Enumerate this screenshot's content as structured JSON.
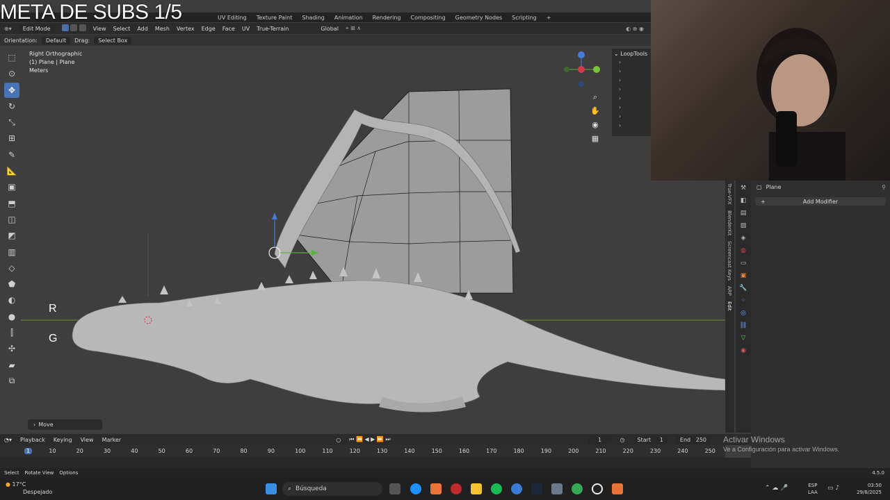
{
  "overlay_title": "META DE SUBS 1/5",
  "topbar": {
    "tabs": [
      "UV Editing",
      "Texture Paint",
      "Shading",
      "Animation",
      "Rendering",
      "Compositing",
      "Geometry Nodes",
      "Scripting",
      "+"
    ]
  },
  "header": {
    "mode": "Edit Mode",
    "menus": [
      "View",
      "Select",
      "Add",
      "Mesh",
      "Vertex",
      "Edge",
      "Face",
      "UV",
      "True-Terrain"
    ],
    "transform_orientation": "Global"
  },
  "tool_settings": {
    "orientation_label": "Orientation:",
    "orientation_value": "Default",
    "drag_label": "Drag:",
    "drag_value": "Select Box"
  },
  "viewport": {
    "view_name": "Right Orthographic",
    "object_info": "(1) Plane | Plane",
    "units": "Meters",
    "key_r": "R",
    "key_g": "G",
    "last_op": "Move",
    "axes": {
      "x": "X",
      "y": "Y",
      "z": "Z"
    }
  },
  "looptools": {
    "title": "LoopTools",
    "rows": 8
  },
  "sidebar_tabs": [
    "True-VFX",
    "BlenderKit",
    "Screencast Keys",
    "ARP",
    "Edit"
  ],
  "properties": {
    "object_name": "Plane",
    "add_modifier": "Add Modifier"
  },
  "timeline": {
    "menus": [
      "Playback",
      "Keying",
      "View",
      "Marker"
    ],
    "current_frame": "1",
    "start_label": "Start",
    "start_value": "1",
    "end_label": "End",
    "end_value": "250",
    "ruler": [
      "1",
      "10",
      "20",
      "30",
      "40",
      "50",
      "60",
      "70",
      "80",
      "90",
      "100",
      "110",
      "120",
      "130",
      "140",
      "150",
      "160",
      "170",
      "180",
      "190",
      "200",
      "210",
      "220",
      "230",
      "240",
      "250"
    ]
  },
  "statusbar": {
    "items": [
      "Select",
      "Rotate View",
      "Options"
    ],
    "version": "4.5.0"
  },
  "activation": {
    "line1": "Activar Windows",
    "line2": "Ve a Configuración para activar Windows."
  },
  "taskbar": {
    "weather_temp": "17°C",
    "weather_desc": "Despejado",
    "search_placeholder": "Búsqueda",
    "lang1": "ESP",
    "lang2": "LAA",
    "time": "03:50",
    "date": "29/8/2025"
  }
}
